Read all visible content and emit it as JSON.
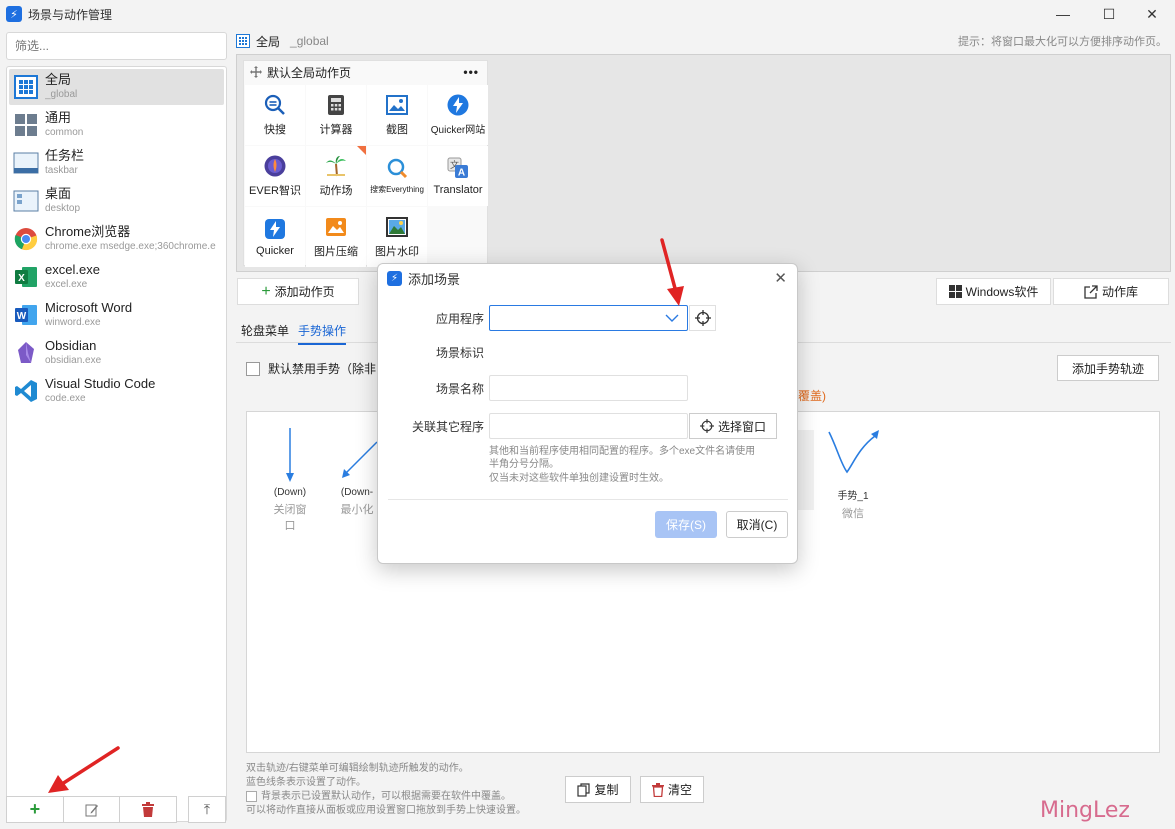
{
  "window": {
    "title": "场景与动作管理",
    "minimize": "—",
    "maximize": "☐",
    "close": "✕"
  },
  "sidebar": {
    "filter_placeholder": "筛选...",
    "scenes": [
      {
        "name": "全局",
        "sub": "_global",
        "icon": "grid-icon",
        "selected": true
      },
      {
        "name": "通用",
        "sub": "common",
        "icon": "tiles-icon"
      },
      {
        "name": "任务栏",
        "sub": "taskbar",
        "icon": "taskbar-icon"
      },
      {
        "name": "桌面",
        "sub": "desktop",
        "icon": "desktop-icon"
      },
      {
        "name": "Chrome浏览器",
        "sub": "chrome.exe  msedge.exe;360chrome.e",
        "icon": "chrome-icon"
      },
      {
        "name": "excel.exe",
        "sub": "excel.exe",
        "icon": "excel-icon"
      },
      {
        "name": "Microsoft Word",
        "sub": "winword.exe",
        "icon": "word-icon"
      },
      {
        "name": "Obsidian",
        "sub": "obsidian.exe",
        "icon": "obsidian-icon"
      },
      {
        "name": "Visual Studio Code",
        "sub": "code.exe",
        "icon": "vscode-icon"
      }
    ],
    "bottom": {
      "add": "+",
      "edit": "✎",
      "delete": "🗑",
      "up": "⤒"
    }
  },
  "header": {
    "title": "全局",
    "sub": "_global",
    "hint": "提示：将窗口最大化可以方便排序动作页。"
  },
  "panel": {
    "page_title": "默认全局动作页",
    "more": "•••",
    "tiles": [
      {
        "label": "快搜",
        "icon": "search-plus-icon"
      },
      {
        "label": "计算器",
        "icon": "calculator-icon"
      },
      {
        "label": "截图",
        "icon": "screenshot-icon"
      },
      {
        "label": "Quicker网站",
        "icon": "quicker-bolt-icon"
      },
      {
        "label": "EVER智识",
        "icon": "ever-icon"
      },
      {
        "label": "动作场",
        "icon": "palm-icon"
      },
      {
        "label": "搜索Everything",
        "icon": "everything-search-icon"
      },
      {
        "label": "Translator",
        "icon": "translator-icon"
      },
      {
        "label": "Quicker",
        "icon": "quicker-app-icon"
      },
      {
        "label": "图片压缩",
        "icon": "image-compress-icon"
      },
      {
        "label": "图片水印",
        "icon": "image-watermark-icon"
      }
    ],
    "add_page": "添加动作页",
    "windows_software": "Windows软件",
    "action_library": "动作库"
  },
  "tabs": {
    "wheel": "轮盘菜单",
    "gesture": "手势操作"
  },
  "gesture": {
    "disable_label": "默认禁用手势（除非",
    "orange_tail": "覆盖)",
    "add_trace": "添加手势轨迹",
    "items": [
      {
        "name": "(Down)",
        "action": "关闭窗口"
      },
      {
        "name": "(Down-",
        "action": "最小化"
      },
      {
        "name": "手势_1",
        "action": "微信"
      }
    ],
    "notes": [
      "双击轨迹/右键菜单可编辑绘制轨迹所触发的动作。",
      "蓝色线条表示设置了动作。",
      "背景表示已设置默认动作，可以根据需要在软件中覆盖。",
      "可以将动作直接从面板或应用设置窗口拖放到手势上快速设置。"
    ],
    "copy": "复制",
    "clear": "清空"
  },
  "dialog": {
    "title": "添加场景",
    "close": "✕",
    "app_label": "应用程序",
    "id_label": "场景标识",
    "name_label": "场景名称",
    "related_label": "关联其它程序",
    "pick_window": "选择窗口",
    "desc1": "其他和当前程序使用相同配置的程序。多个exe文件名请使用",
    "desc2": "半角分号分隔。",
    "desc3": "仅当未对这些软件单独创建设置时生效。",
    "save": "保存(S)",
    "cancel": "取消(C)"
  },
  "watermark": "MingLez",
  "colors": {
    "accent": "#1a66d4",
    "arrow": "#e02424",
    "save_disabled": "#a8c4f5"
  }
}
